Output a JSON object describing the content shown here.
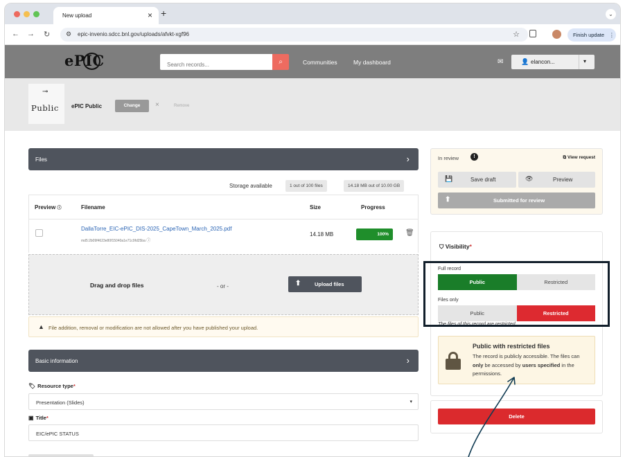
{
  "browser": {
    "tab_title": "New upload",
    "url": "epic-invenio.sdcc.bnl.gov/uploads/afvkt-xgf96",
    "finish_update": "Finish update",
    "colors": {
      "close": "#ed6a5e",
      "minimize": "#f5bf4f",
      "maximize": "#61c454"
    }
  },
  "header": {
    "logo": "ePIC",
    "search_placeholder": "Search records...",
    "nav": [
      "Communities",
      "My dashboard"
    ],
    "user": "elancon..."
  },
  "community": {
    "logo_text": "Public",
    "name": "ePIC Public",
    "change": "Change",
    "remove": "Remove"
  },
  "files": {
    "section_title": "Files",
    "storage_label": "Storage available",
    "files_badge": "1 out of 100 files",
    "size_badge": "14.18 MB out of 10.00 GB",
    "columns": {
      "preview": "Preview",
      "filename": "Filename",
      "size": "Size",
      "progress": "Progress"
    },
    "rows": [
      {
        "filename": "DallaTorre_EIC-ePIC_DIS-2025_CapeTown_March_2025.pdf",
        "checksum": "md5:2b09f4623e80f15040a1e71c9fd25ba",
        "size": "14.18 MB",
        "progress": "100%",
        "progress_fraction": 1.0
      }
    ],
    "drop_label": "Drag and drop files",
    "or": "- or -",
    "upload_button": "Upload files",
    "warning": "File addition, removal or modification are not allowed after you have published your upload."
  },
  "basic": {
    "section_title": "Basic information",
    "resource_type_label": "Resource type",
    "resource_type_value": "Presentation (Slides)",
    "title_label": "Title",
    "title_value": "EIC/ePIC STATUS"
  },
  "review": {
    "status": "In review",
    "view_request": "View request",
    "save_draft": "Save draft",
    "preview": "Preview",
    "submitted": "Submitted for review"
  },
  "visibility": {
    "title": "Visibility",
    "full_record_label": "Full record",
    "files_only_label": "Files only",
    "public": "Public",
    "restricted": "Restricted",
    "note": "The files of this record are restricted.",
    "info_title": "Public with restricted files",
    "info_text_1": "The record is publicly accessible. The files can ",
    "info_only": "only",
    "info_text_2": " be accessed by ",
    "info_users": "users specified",
    "info_text_3": " in the permissions.",
    "colors": {
      "public_on": "#1a7d29",
      "restricted_on": "#dd2a30"
    }
  },
  "delete": {
    "label": "Delete",
    "color": "#db2a2d"
  }
}
